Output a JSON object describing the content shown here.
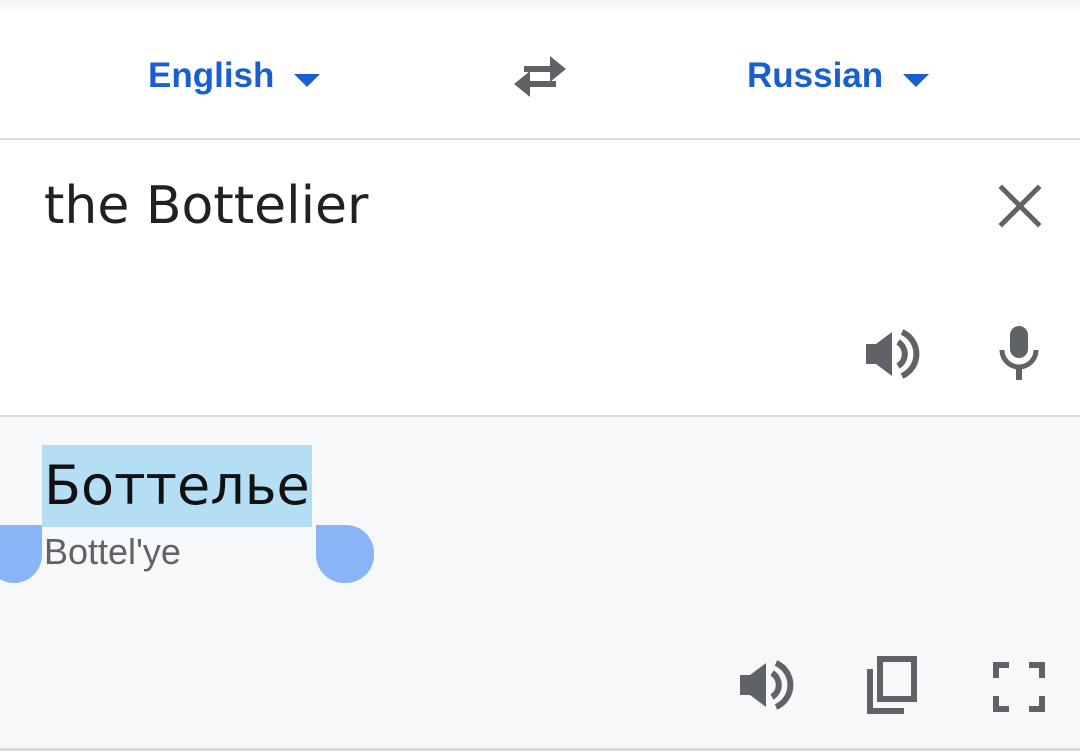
{
  "language_bar": {
    "source_language": "English",
    "target_language": "Russian",
    "icons": {
      "source_caret": "caret-down-icon",
      "target_caret": "caret-down-icon",
      "swap": "swap-languages-icon"
    }
  },
  "input": {
    "text": "the Bottelier",
    "icons": {
      "clear": "close-icon",
      "speak": "speaker-icon",
      "voice": "microphone-icon"
    }
  },
  "output": {
    "translation": "Боттелье",
    "transliteration": "Bottel'ye",
    "selection_highlighted": true,
    "icons": {
      "speak": "speaker-icon",
      "copy": "copy-icon",
      "fullscreen": "fullscreen-icon"
    }
  },
  "colors": {
    "accent_blue": "#1a5fd0",
    "selection_highlight": "#b3def3",
    "selection_handle": "#8ab4f8",
    "output_background": "#f7f8fa",
    "icon_gray": "#5f6368"
  }
}
